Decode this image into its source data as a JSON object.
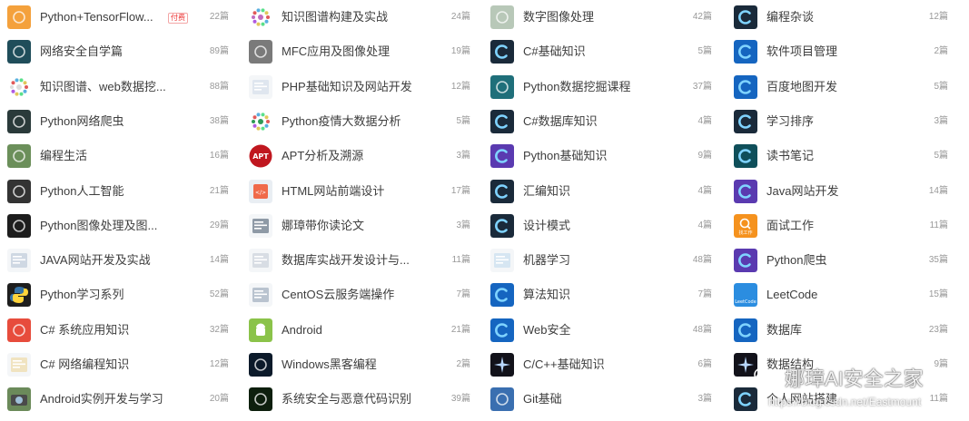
{
  "columns": [
    {
      "items": [
        {
          "label": "Python+TensorFlow...",
          "count": "22篇",
          "badge": "付费",
          "icon": "tensorflow-icon",
          "color": "#f4a13c"
        },
        {
          "label": "网络安全自学篇",
          "count": "89篇",
          "icon": "network-icon",
          "color": "#1f4d5a"
        },
        {
          "label": "知识图谱、web数据挖...",
          "count": "88篇",
          "icon": "graph-icon",
          "color": "#dddddd"
        },
        {
          "label": "Python网络爬虫",
          "count": "38篇",
          "icon": "spider-icon",
          "color": "#2a3a3a"
        },
        {
          "label": "编程生活",
          "count": "16篇",
          "icon": "landscape-icon",
          "color": "#6b8f5a"
        },
        {
          "label": "Python人工智能",
          "count": "21篇",
          "icon": "ai-bars-icon",
          "color": "#333333"
        },
        {
          "label": "Python图像处理及图...",
          "count": "29篇",
          "icon": "image-process-icon",
          "color": "#1d1d1d"
        },
        {
          "label": "JAVA网站开发及实战",
          "count": "14篇",
          "icon": "web-screen-icon",
          "color": "#cfd8e3"
        },
        {
          "label": "Python学习系列",
          "count": "52篇",
          "icon": "python-logo-icon",
          "color": "#3572a5"
        },
        {
          "label": "C# 系统应用知识",
          "count": "32篇",
          "icon": "csharp-window-icon",
          "color": "#e74c3c"
        },
        {
          "label": "C# 网络编程知识",
          "count": "12篇",
          "icon": "document-icon",
          "color": "#f0e3c0"
        },
        {
          "label": "Android实例开发与学习",
          "count": "20篇",
          "icon": "camera-icon",
          "color": "#4a4a4a"
        }
      ]
    },
    {
      "items": [
        {
          "label": "知识图谱构建及实战",
          "count": "24篇",
          "icon": "graph-colorful-icon",
          "color": "#c06cc0"
        },
        {
          "label": "MFC应用及图像处理",
          "count": "19篇",
          "icon": "mfc-image-icon",
          "color": "#7a7a7a"
        },
        {
          "label": "PHP基础知识及网站开发",
          "count": "12篇",
          "icon": "php-web-icon",
          "color": "#dfe6ef"
        },
        {
          "label": "Python疫情大数据分析",
          "count": "5篇",
          "icon": "virus-icon",
          "color": "#2f9a56"
        },
        {
          "label": "APT分析及溯源",
          "count": "3篇",
          "icon": "apt-icon",
          "color": "#c0171f"
        },
        {
          "label": "HTML网站前端设计",
          "count": "17篇",
          "icon": "html-icon",
          "color": "#f06a4a"
        },
        {
          "label": "娜璋带你读论文",
          "count": "3篇",
          "icon": "paper-icon",
          "color": "#8f9aa6"
        },
        {
          "label": "数据库实战开发设计与...",
          "count": "11篇",
          "icon": "database-doc-icon",
          "color": "#d8dde4"
        },
        {
          "label": "CentOS云服务端操作",
          "count": "7篇",
          "icon": "centos-icon",
          "color": "#b9c3cf"
        },
        {
          "label": "Android",
          "count": "21篇",
          "icon": "android-icon",
          "color": "#8bc34a"
        },
        {
          "label": "Windows黑客编程",
          "count": "2篇",
          "icon": "hacker-icon",
          "color": "#0c1a2a"
        },
        {
          "label": "系统安全与恶意代码识别",
          "count": "39篇",
          "icon": "malware-icon",
          "color": "#0d1f0d"
        }
      ]
    },
    {
      "items": [
        {
          "label": "数字图像处理",
          "count": "42篇",
          "icon": "digital-image-icon",
          "color": "#b8c8b8"
        },
        {
          "label": "C#基础知识",
          "count": "5篇",
          "icon": "csdn-c-icon",
          "color": "#1a2a3a"
        },
        {
          "label": "Python数据挖掘课程",
          "count": "37篇",
          "icon": "data-mining-icon",
          "color": "#1f6f7a"
        },
        {
          "label": "C#数据库知识",
          "count": "4篇",
          "icon": "csdn-c-icon",
          "color": "#1a2a3a"
        },
        {
          "label": "Python基础知识",
          "count": "9篇",
          "icon": "csdn-c-purple-icon",
          "color": "#5a3ab0"
        },
        {
          "label": "汇编知识",
          "count": "4篇",
          "icon": "csdn-c-icon",
          "color": "#1a2a3a"
        },
        {
          "label": "设计模式",
          "count": "4篇",
          "icon": "csdn-c-icon",
          "color": "#1a2a3a"
        },
        {
          "label": "机器学习",
          "count": "48篇",
          "icon": "machine-learning-icon",
          "color": "#d6e6f2"
        },
        {
          "label": "算法知识",
          "count": "7篇",
          "icon": "csdn-c-blue-icon",
          "color": "#1565c0"
        },
        {
          "label": "Web安全",
          "count": "48篇",
          "icon": "csdn-c-blue-icon",
          "color": "#1565c0"
        },
        {
          "label": "C/C++基础知识",
          "count": "6篇",
          "icon": "sparkle-icon",
          "color": "#12121a"
        },
        {
          "label": "Git基础",
          "count": "3篇",
          "icon": "git-icon",
          "color": "#3a6fb0"
        }
      ]
    },
    {
      "items": [
        {
          "label": "编程杂谈",
          "count": "12篇",
          "icon": "csdn-c-icon",
          "color": "#1a2a3a"
        },
        {
          "label": "软件项目管理",
          "count": "2篇",
          "icon": "csdn-c-blue-icon",
          "color": "#1565c0"
        },
        {
          "label": "百度地图开发",
          "count": "5篇",
          "icon": "csdn-c-blue-icon",
          "color": "#1565c0"
        },
        {
          "label": "学习排序",
          "count": "3篇",
          "icon": "csdn-c-icon",
          "color": "#1a2a3a"
        },
        {
          "label": "读书笔记",
          "count": "5篇",
          "icon": "csdn-c-teal-icon",
          "color": "#0f4f5a"
        },
        {
          "label": "Java网站开发",
          "count": "14篇",
          "icon": "csdn-c-purple-icon",
          "color": "#5a3ab0"
        },
        {
          "label": "面试工作",
          "count": "11篇",
          "icon": "job-search-icon",
          "color": "#f5921e",
          "icon_text": "找工作"
        },
        {
          "label": "Python爬虫",
          "count": "35篇",
          "icon": "csdn-c-purple-icon",
          "color": "#5a3ab0"
        },
        {
          "label": "LeetCode",
          "count": "15篇",
          "icon": "leetcode-icon",
          "color": "#2b8de0",
          "icon_text": "LeetCode"
        },
        {
          "label": "数据库",
          "count": "23篇",
          "icon": "csdn-c-blue-icon",
          "color": "#1565c0"
        },
        {
          "label": "数据结构",
          "count": "9篇",
          "icon": "sparkle-icon",
          "color": "#12121a"
        },
        {
          "label": "个人网站搭建",
          "count": "11篇",
          "icon": "csdn-c-icon",
          "color": "#1a2a3a"
        }
      ]
    }
  ],
  "watermark": {
    "title": "娜璋AI安全之家",
    "url": "https://blog.csdn.net/Eastmount"
  }
}
